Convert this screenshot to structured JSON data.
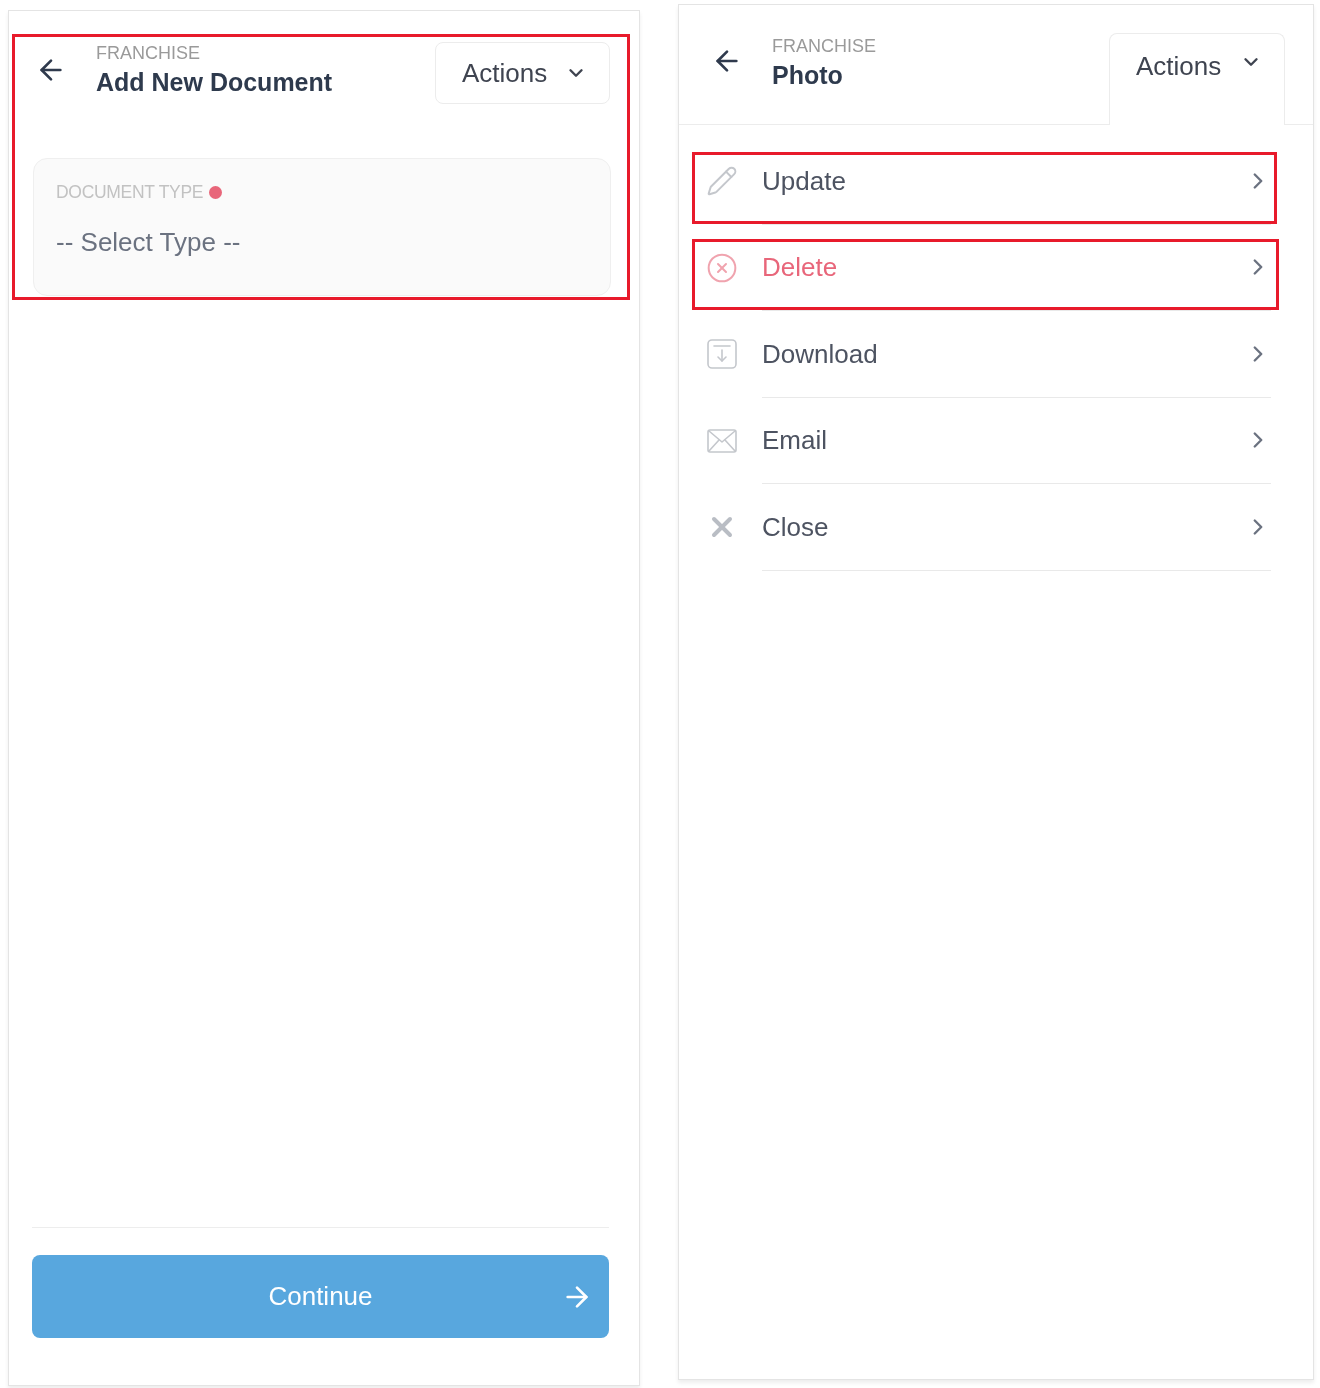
{
  "screens": [
    {
      "kind": "form",
      "highlighted": true,
      "header": {
        "eyebrow": "FRANCHISE",
        "title": "Add New Document",
        "actions": {
          "label": "Actions",
          "expanded": false
        }
      },
      "field": {
        "label": "DOCUMENT TYPE",
        "required": true,
        "placeholder": "-- Select Type --"
      },
      "submit": {
        "label": "Continue"
      }
    },
    {
      "kind": "menu",
      "header": {
        "eyebrow": "FRANCHISE",
        "title": "Photo",
        "actions": {
          "label": "Actions",
          "expanded": true
        }
      },
      "items": [
        {
          "kind": "update",
          "label": "Update",
          "danger": false,
          "highlighted": true
        },
        {
          "kind": "delete",
          "label": "Delete",
          "danger": true,
          "highlighted": true
        },
        {
          "kind": "download",
          "label": "Download",
          "danger": false,
          "highlighted": false
        },
        {
          "kind": "email",
          "label": "Email",
          "danger": false,
          "highlighted": false
        },
        {
          "kind": "close",
          "label": "Close",
          "danger": false,
          "highlighted": false
        }
      ]
    }
  ]
}
